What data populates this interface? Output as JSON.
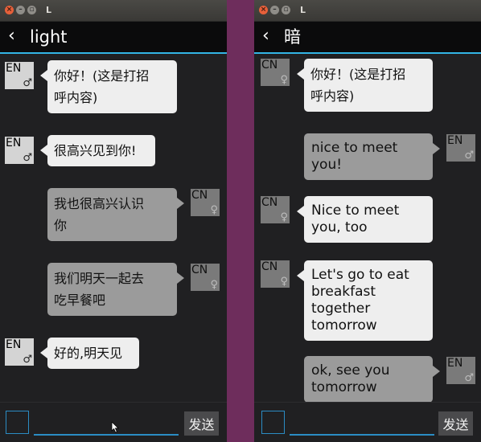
{
  "windows": {
    "left": {
      "window_title": "L",
      "app_title": "light",
      "messages": [
        {
          "lang": "EN",
          "gender": "♂",
          "text_lines": [
            "你好！(这是打招",
            "呼内容)"
          ]
        },
        {
          "lang": "EN",
          "gender": "♂",
          "text_lines": [
            "很高兴见到你!"
          ]
        },
        {
          "lang": "CN",
          "gender": "♀",
          "text_lines": [
            "我也很高兴认识",
            "你"
          ]
        },
        {
          "lang": "CN",
          "gender": "♀",
          "text_lines": [
            "我们明天一起去",
            "吃早餐吧"
          ]
        },
        {
          "lang": "EN",
          "gender": "♂",
          "text_lines": [
            "好的,明天见"
          ]
        }
      ],
      "input": {
        "value": "",
        "send_label": "发送"
      }
    },
    "right": {
      "window_title": "L",
      "app_title": "暗",
      "messages": [
        {
          "lang": "CN",
          "gender": "♀",
          "text_lines": [
            "你好！(这是打招",
            "呼内容)"
          ]
        },
        {
          "lang": "EN",
          "gender": "♂",
          "text_lines": [
            "nice to meet",
            "you!"
          ]
        },
        {
          "lang": "CN",
          "gender": "♀",
          "text_lines": [
            "Nice to meet",
            "you, too"
          ]
        },
        {
          "lang": "CN",
          "gender": "♀",
          "text_lines": [
            "Let's go to eat",
            "breakfast",
            "together",
            "tomorrow"
          ]
        },
        {
          "lang": "EN",
          "gender": "♂",
          "text_lines": [
            "ok, see you",
            "tomorrow"
          ]
        }
      ],
      "input": {
        "value": "",
        "send_label": "发送"
      }
    }
  },
  "icons": {
    "close": "close-icon",
    "minimize": "minimize-icon",
    "maximize": "maximize-icon",
    "back": "chevron-left-icon",
    "male": "male-icon",
    "female": "female-icon",
    "cursor": "mouse-pointer-icon"
  },
  "colors": {
    "accent": "#33b5e5",
    "desktop": "#6e2d5c",
    "chat_bg": "#202022",
    "bubble_light": "#eeeeee",
    "bubble_dark": "#9b9b9b"
  }
}
